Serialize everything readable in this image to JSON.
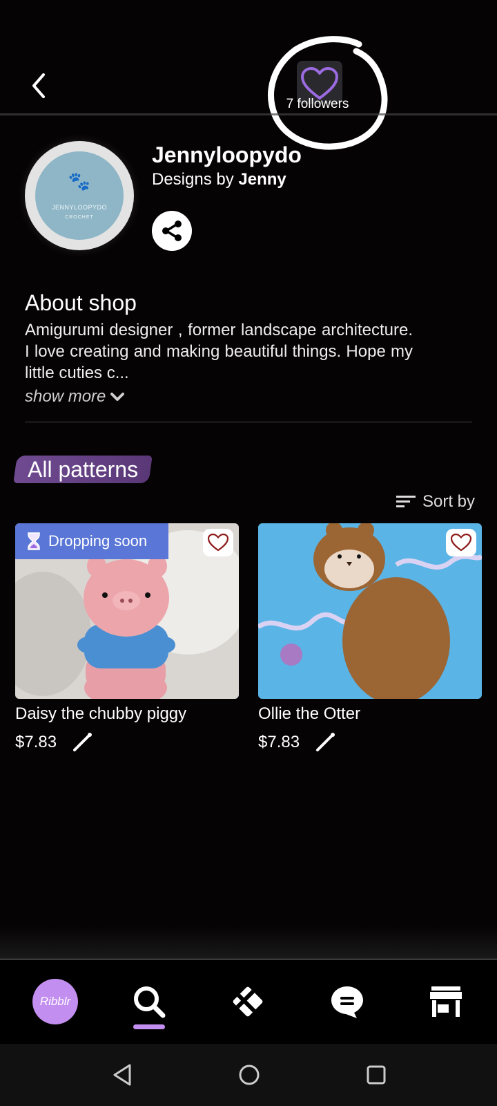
{
  "header": {
    "back_icon": "chevron-left-icon",
    "follow_icon": "heart-icon",
    "followers": "7 followers",
    "accent_color": "#9b6be0"
  },
  "profile": {
    "avatar_line1": "JENNYLOOPYDO",
    "avatar_line2": "CROCHET",
    "shop_name": "Jennyloopydo",
    "subtitle_prefix": "Designs by",
    "subtitle_name": "Jenny",
    "share_icon": "share-icon"
  },
  "about": {
    "title": "About shop",
    "text": "Amigurumi designer , former landscape architecture. I love creating and making beautiful things. Hope my little cuties c...",
    "show_more": "show more"
  },
  "patterns": {
    "section_label": "All patterns",
    "sort_label": "Sort by",
    "items": [
      {
        "title": "Daisy the chubby piggy",
        "price": "$7.83",
        "badge": "Dropping soon"
      },
      {
        "title": "Ollie the Otter",
        "price": "$7.83"
      }
    ]
  },
  "tabbar": {
    "logo": "Ribblr",
    "tabs": [
      "home-logo",
      "search-icon",
      "patterns-icon",
      "chat-icon",
      "shop-icon"
    ],
    "active": "search"
  }
}
